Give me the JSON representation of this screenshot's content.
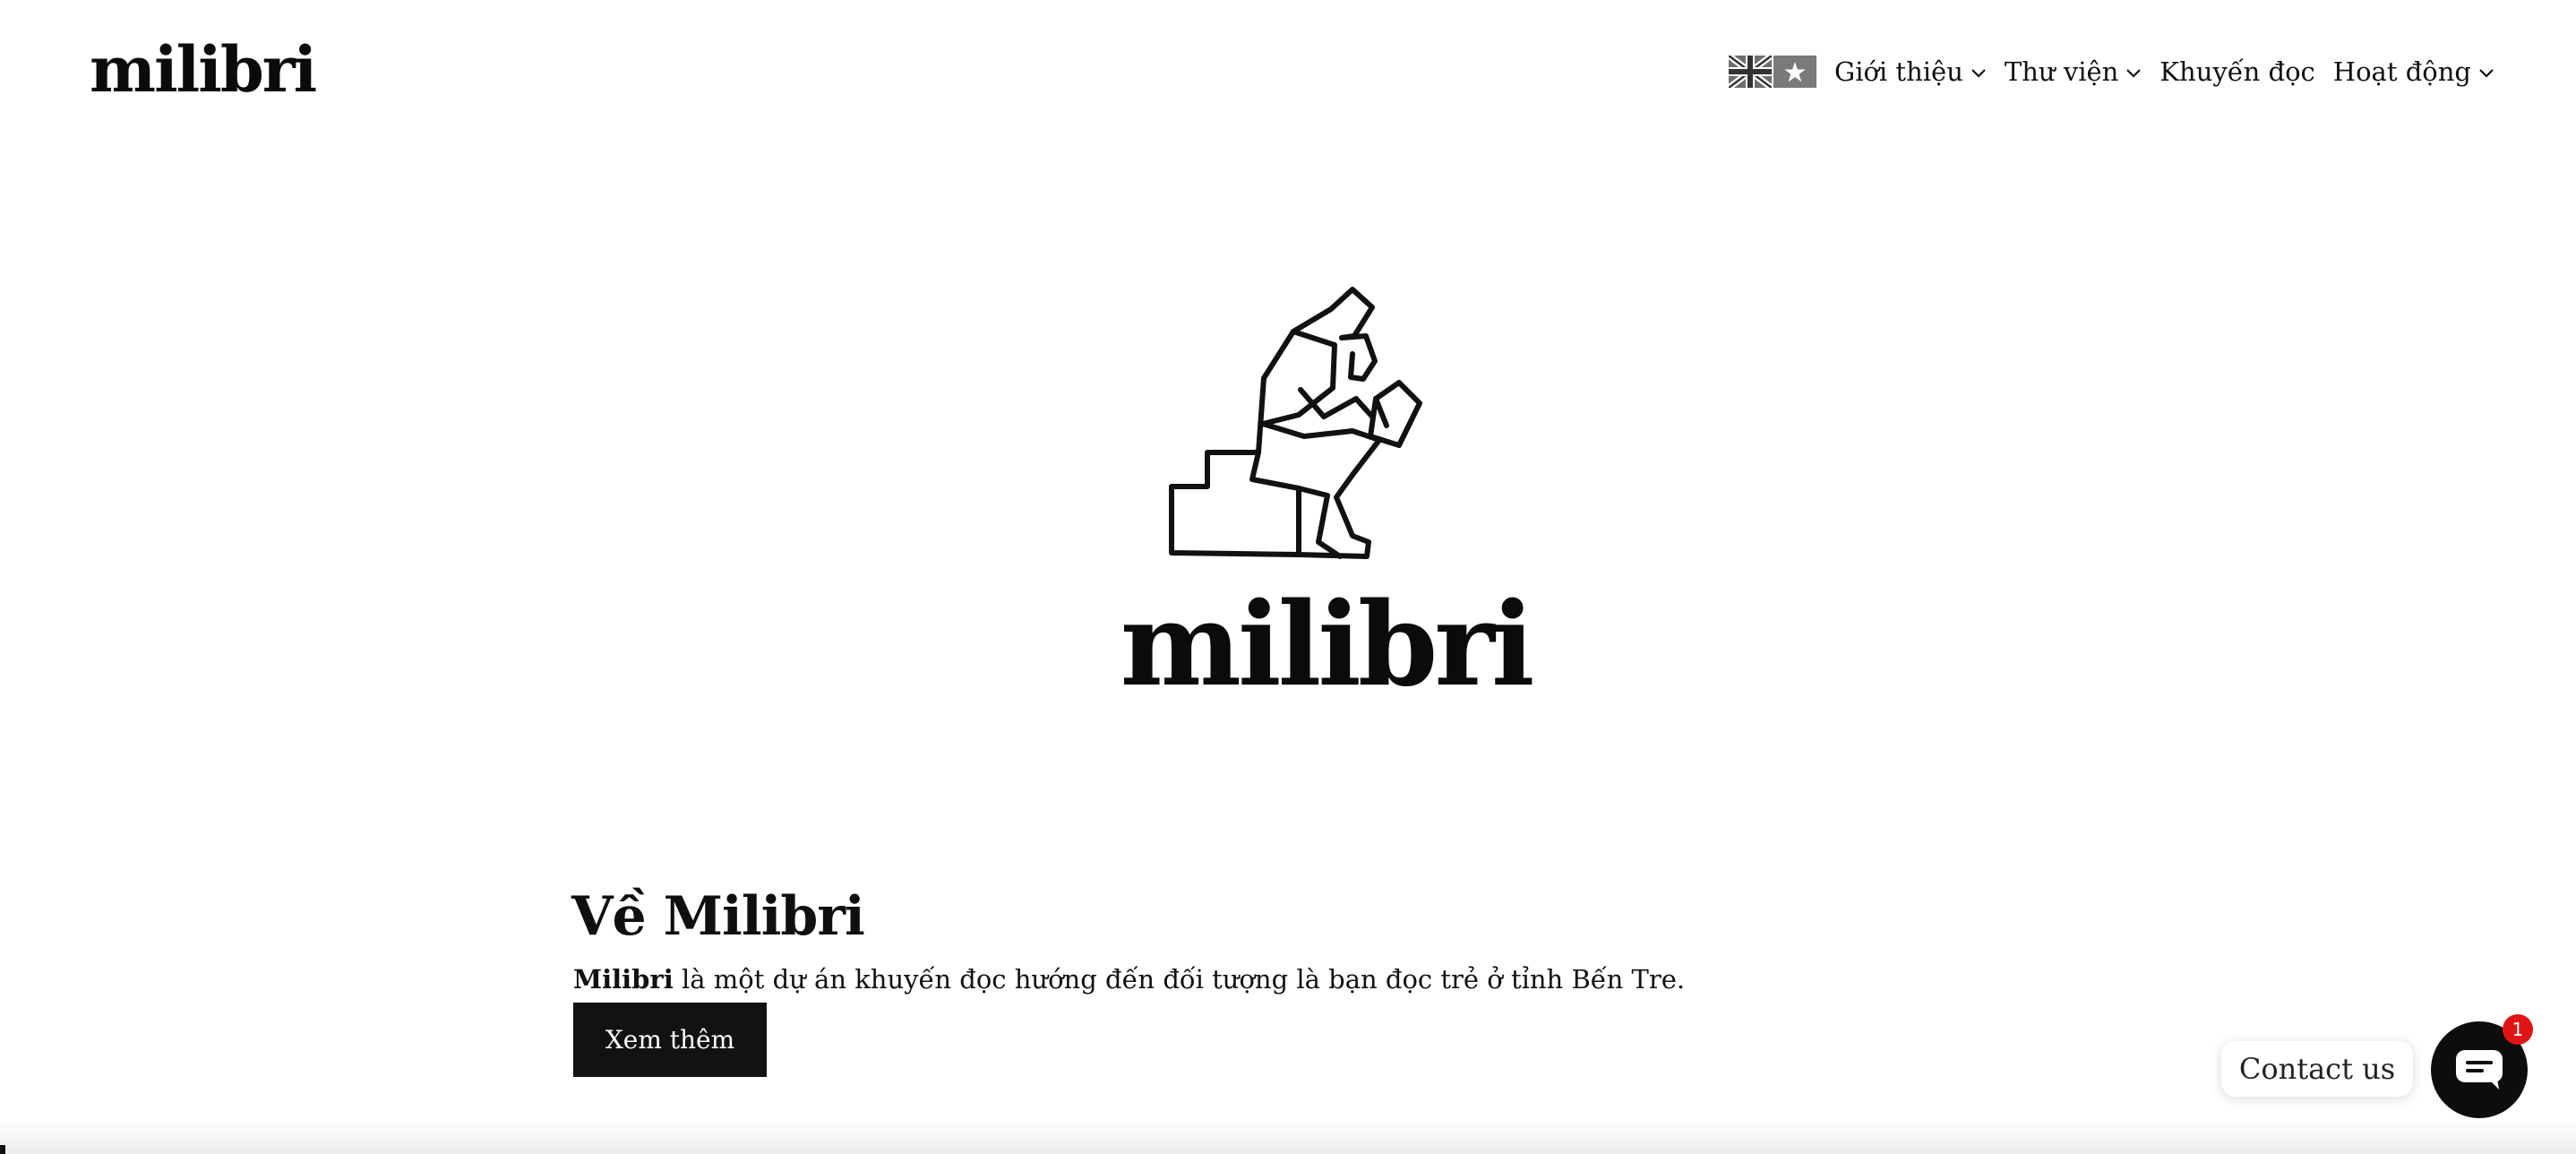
{
  "header": {
    "brand": "milibri",
    "languages": [
      {
        "icon": "uk-flag-icon",
        "label": "English"
      },
      {
        "icon": "vietnam-flag-icon",
        "label": "Tiếng Việt"
      }
    ],
    "nav": [
      {
        "label": "Giới thiệu",
        "has_dropdown": true
      },
      {
        "label": "Thư viện",
        "has_dropdown": true
      },
      {
        "label": "Khuyến đọc",
        "has_dropdown": false
      },
      {
        "label": "Hoạt động",
        "has_dropdown": true
      }
    ]
  },
  "hero": {
    "logo_icon": "reading-thinker-icon",
    "wordmark": "milibri"
  },
  "about": {
    "title": "Về Milibri",
    "desc_bold": "Milibri",
    "desc_rest": " là một dự án khuyến đọc hướng đến đối tượng là bạn đọc trẻ ở tỉnh Bến Tre.",
    "button": "Xem thêm"
  },
  "contact": {
    "label": "Contact us",
    "badge": "1",
    "icon": "chat-icon"
  },
  "colors": {
    "primary": "#121212",
    "badge": "#e01414",
    "background": "#ffffff"
  }
}
